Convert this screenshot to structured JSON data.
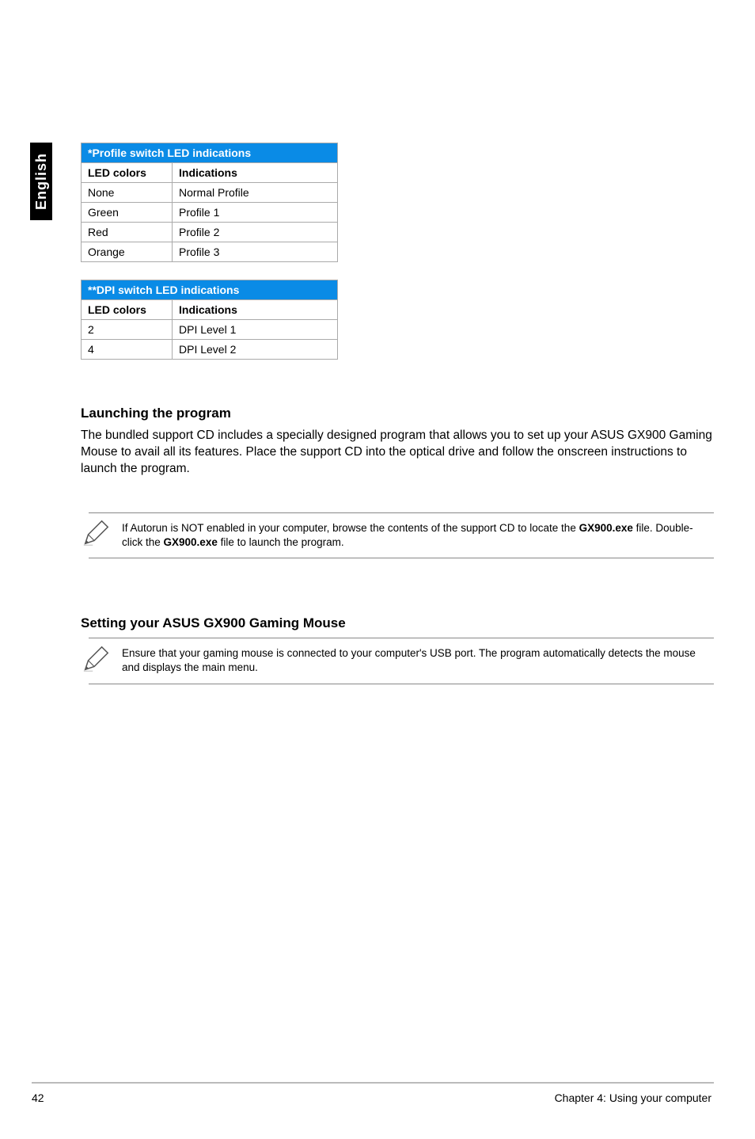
{
  "side_tab": "English",
  "tables": {
    "profile": {
      "title": "*Profile switch LED indications",
      "col1": "LED colors",
      "col2": "Indications",
      "rows": [
        {
          "c1": "None",
          "c2": "Normal Profile"
        },
        {
          "c1": "Green",
          "c2": "Profile 1"
        },
        {
          "c1": "Red",
          "c2": "Profile 2"
        },
        {
          "c1": "Orange",
          "c2": "Profile 3"
        }
      ]
    },
    "dpi": {
      "title": "**DPI switch LED indications",
      "col1": "LED colors",
      "col2": "Indications",
      "rows": [
        {
          "c1": "2",
          "c2": "DPI Level 1"
        },
        {
          "c1": "4",
          "c2": "DPI Level 2"
        }
      ]
    }
  },
  "sections": {
    "launch": {
      "heading": "Launching the program",
      "body": "The bundled support CD includes a specially designed program that allows you to set up your ASUS GX900 Gaming Mouse to avail all its features. Place the support CD into the optical drive and follow the onscreen instructions to launch the program.",
      "note_pre": "If Autorun is NOT enabled in your computer, browse the contents of the support CD to locate the ",
      "note_b1": "GX900.exe",
      "note_mid": " file. Double-click the ",
      "note_b2": "GX900.exe",
      "note_post": " file to launch the program."
    },
    "setting": {
      "heading": "Setting your ASUS GX900 Gaming Mouse",
      "note": "Ensure that your gaming mouse is connected to your computer's USB port. The program automatically detects the mouse and displays the main menu."
    }
  },
  "footer": {
    "page": "42",
    "chapter": "Chapter 4: Using your computer"
  }
}
